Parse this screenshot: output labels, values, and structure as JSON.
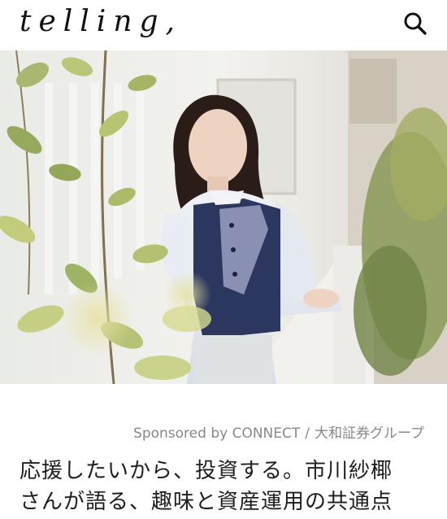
{
  "header": {
    "logo_text": "telling,",
    "search_icon": "search-icon"
  },
  "hero": {
    "image_description_icon": "photo-woman-on-balcony"
  },
  "article": {
    "sponsor_prefix": "Sponsored by CONNECT",
    "sponsor_separator": "/",
    "sponsor_group": "大和証券グループ",
    "title_line1": "応援したいから、投資する。市川紗椰",
    "title_line2": "さんが語る、趣味と資産運用の共通点"
  },
  "colors": {
    "accent_text": "#1e1e1e",
    "sponsor_text": "#888888",
    "vest": "#2c3760"
  }
}
